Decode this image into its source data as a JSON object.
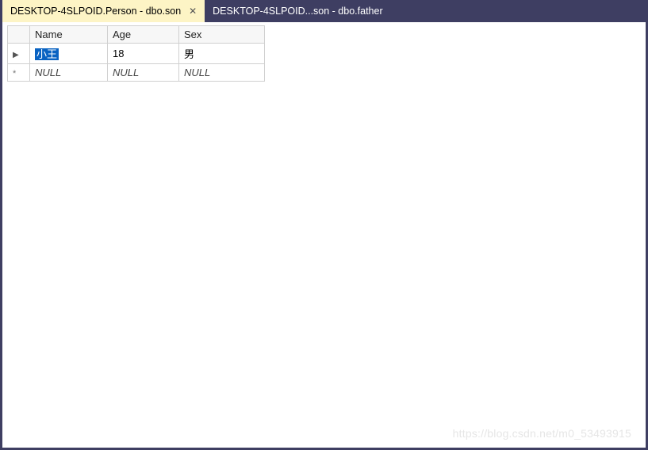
{
  "tabs": [
    {
      "label": "DESKTOP-4SLPOID.Person - dbo.son",
      "active": true,
      "closable": true
    },
    {
      "label": "DESKTOP-4SLPOID...son - dbo.father",
      "active": false,
      "closable": false
    }
  ],
  "grid": {
    "columns": [
      "Name",
      "Age",
      "Sex"
    ],
    "rows": [
      {
        "indicator": "pointer",
        "cells": [
          "小王",
          "18",
          "男"
        ],
        "selected_col": 0
      },
      {
        "indicator": "new",
        "cells": [
          "NULL",
          "NULL",
          "NULL"
        ],
        "null": true
      }
    ],
    "null_text": "NULL",
    "pointer_glyph": "▶",
    "new_glyph": "*"
  },
  "watermark": "https://blog.csdn.net/m0_53493915"
}
